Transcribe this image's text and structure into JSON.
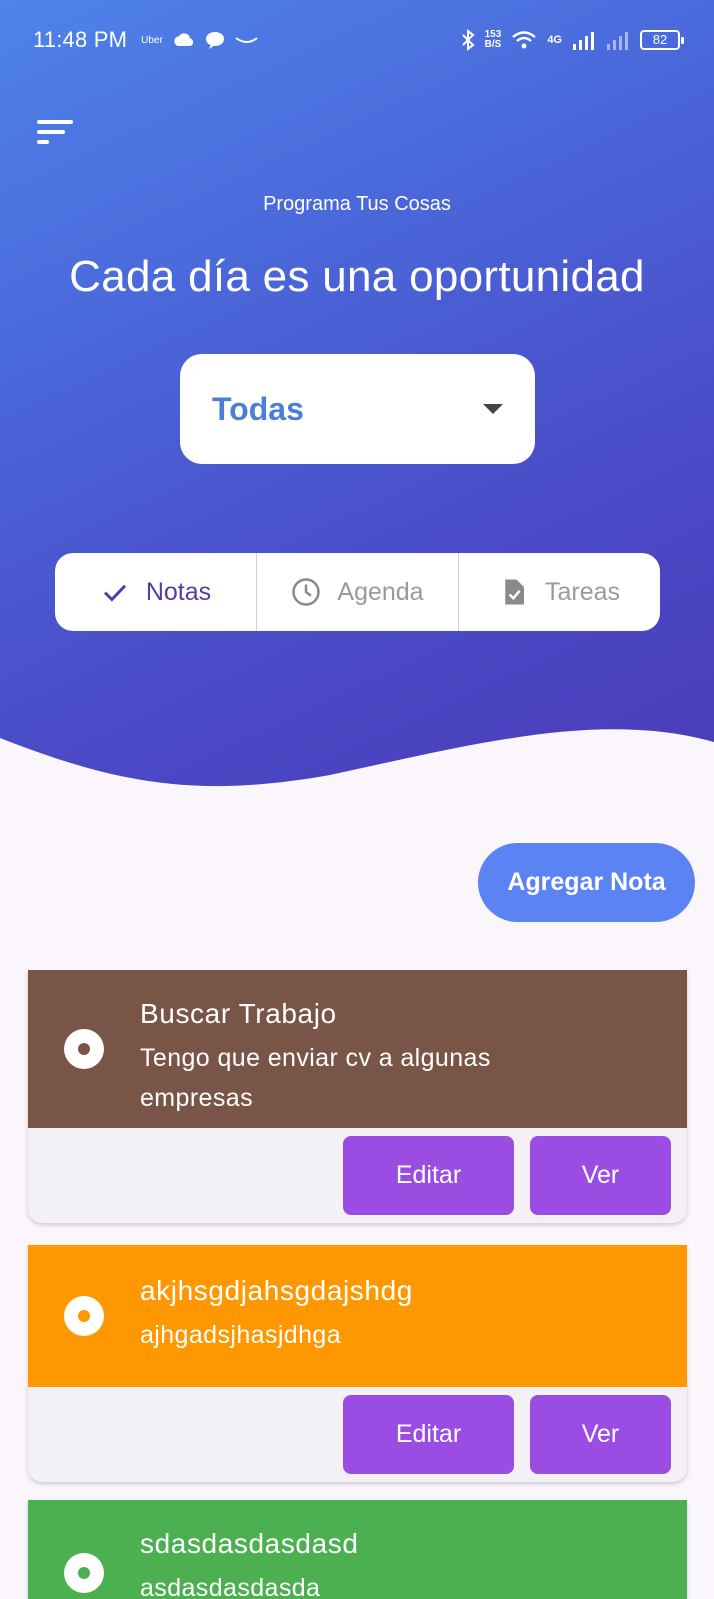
{
  "status_bar": {
    "time": "11:48 PM",
    "uber": "Uber",
    "speed_value": "153",
    "speed_unit": "B/S",
    "network": "4G",
    "battery": "82"
  },
  "app": {
    "subtitle": "Programa Tus Cosas",
    "title": "Cada día es una oportunidad"
  },
  "filter": {
    "selected": "Todas"
  },
  "segments": [
    {
      "label": "Notas",
      "icon": "check-icon",
      "active": true
    },
    {
      "label": "Agenda",
      "icon": "clock-icon",
      "active": false
    },
    {
      "label": "Tareas",
      "icon": "task-file-icon",
      "active": false
    }
  ],
  "add_button": "Agregar Nota",
  "notes": [
    {
      "title": "Buscar Trabajo",
      "description": "Tengo que enviar cv a algunas empresas",
      "color": "#795548"
    },
    {
      "title": "akjhsgdjahsgdajshdg",
      "description": "ajhgadsjhasjdhga",
      "color": "#ff9800"
    },
    {
      "title": "sdasdasdasdasd",
      "description": "asdasdasdasda",
      "color": "#4caf50"
    }
  ],
  "actions": {
    "edit": "Editar",
    "view": "Ver"
  },
  "colors": {
    "accent": "#9b4de3",
    "primary_blue": "#5c83f3",
    "dropdown_text": "#4a7ed8"
  }
}
